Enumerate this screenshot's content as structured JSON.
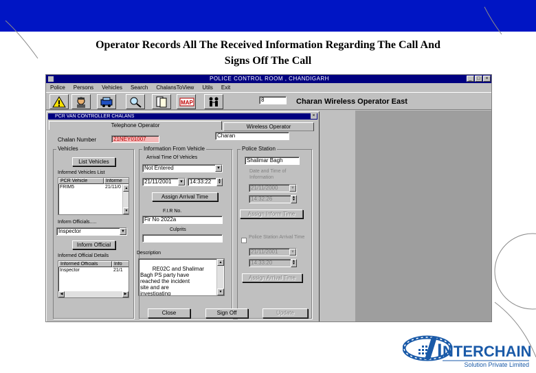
{
  "slide": {
    "title_line1": "Operator Records All The Received Information Regarding The Call And",
    "title_line2": "Signs Off The Call",
    "colors": {
      "top_bar": "#0015c4",
      "logo_blue": "#1a5aa8"
    }
  },
  "window": {
    "title": "POLICE CONTROL ROOM , CHANDIGARH",
    "menu": [
      "Police",
      "Persons",
      "Vehicles",
      "Search",
      "ChalansToView",
      "Utils",
      "Exit"
    ],
    "toolbar_icons": [
      "warning-icon",
      "person-icon",
      "vehicle-icon",
      "search-icon",
      "documents-icon",
      "map-icon",
      "people-icon"
    ],
    "map_label": "MAP",
    "counter_value": "8",
    "status_text": "Charan   Wireless Operator  East"
  },
  "form": {
    "title": "PCR VAN CONTROLLER CHALANS",
    "tabs": {
      "telephone": "Telephone Operator",
      "wireless": "Wireless Operator"
    },
    "wireless_operator_value": "Charan",
    "chalan_number_label": "Chalan Number",
    "chalan_number_value": "21NEY01007",
    "vehicles": {
      "group_label": "Vehicles",
      "list_button": "List Vehicles",
      "informed_list_label": "Informed Vehicles List",
      "columns": [
        "PCR Vehicle",
        "Informe"
      ],
      "rows": [
        [
          "FRIM5",
          "21/11/0"
        ]
      ],
      "inform_officials_label": "Inform Officials.....",
      "official_value": "Inspector",
      "inform_button": "Inform Official",
      "officials_details_label": "Informed Official Details",
      "official_columns": [
        "Informed Officials",
        "Info"
      ],
      "official_rows": [
        [
          "Inspector",
          "21/1"
        ]
      ]
    },
    "from_vehicle": {
      "group_label": "Information From Vehicle",
      "arrival_time_label": "Arrival Time Of Vehicles",
      "arrival_select": "Not Entered",
      "date_value": "21/11/2001",
      "time_value": "14:33:22",
      "assign_arrival_button": "Assign Arrival Time",
      "fir_label": "F.I.R No.",
      "fir_value": "Fir No 2022a",
      "culprits_label": "Culprits",
      "culprits_value": "",
      "description_label": "Description",
      "description_value": "RE02C and Shalimar\nBagh PS party have\nreached the incident\nsite and are\ninvestigating"
    },
    "police_station": {
      "group_label": "Police Station",
      "station_value": "Shalimar Bagh",
      "inform_date_label": "Date and Time of Information",
      "inform_date_value": "21/11/2000",
      "inform_time_value": "14:32:26",
      "assign_inform_button": "Assign Inform Time",
      "arrival_check_label": "Police Station Arrival Time",
      "arrival_date_value": "21/11/2001",
      "arrival_time_value": "14:33:20",
      "assign_arrival_button": "Assign Arrival Time"
    },
    "buttons": {
      "close": "Close",
      "signoff": "Sign Off",
      "update": "Update"
    }
  },
  "logo": {
    "name_initial": "I",
    "name": "NTERCHAIN",
    "tagline": "Solution Private Limited"
  }
}
